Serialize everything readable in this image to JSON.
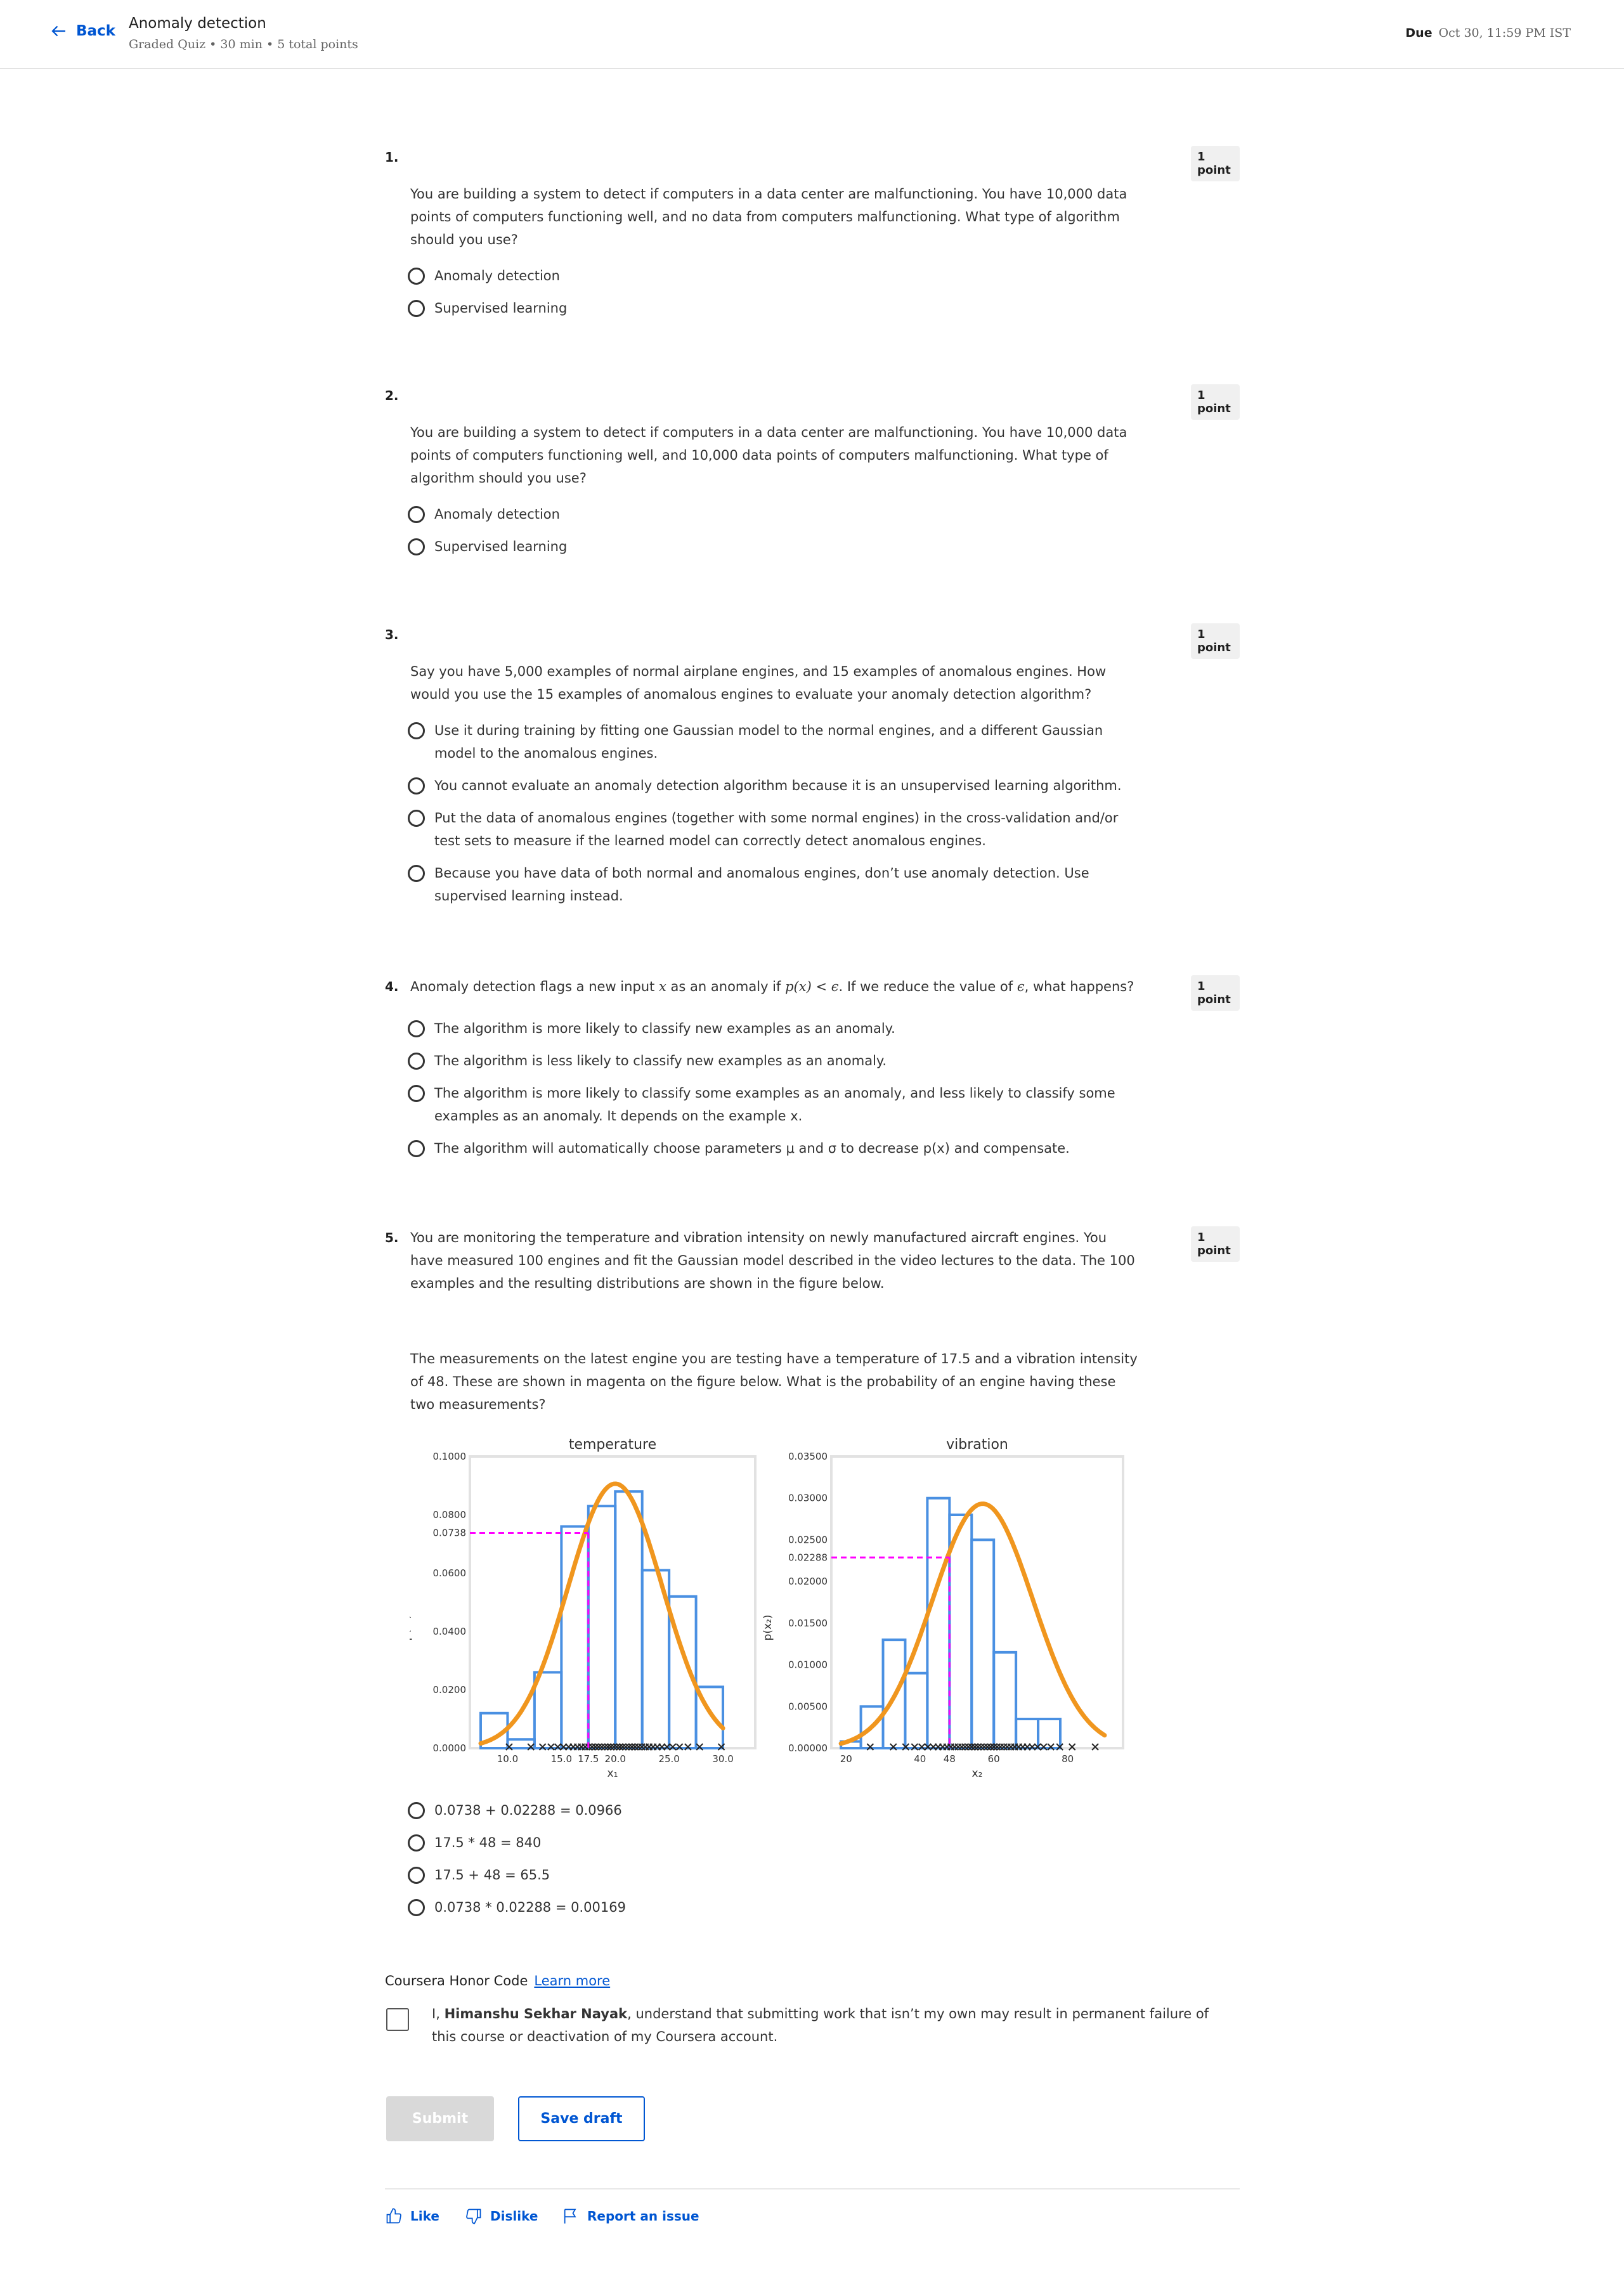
{
  "header": {
    "back_label": "Back",
    "title": "Anomaly detection",
    "subtitle": "Graded Quiz • 30 min • 5 total points",
    "due_label": "Due",
    "due_value": "Oct 30, 11:59 PM IST"
  },
  "questions": [
    {
      "number": "1.",
      "points": "1 point",
      "text": "You are building a system to detect if computers in a data center are malfunctioning. You have 10,000 data points of computers functioning well, and no data from computers malfunctioning. What type of algorithm should you use?",
      "options": [
        "Anomaly detection",
        "Supervised learning"
      ]
    },
    {
      "number": "2.",
      "points": "1 point",
      "text": "You are building a system to detect if computers in a data center are malfunctioning. You have 10,000 data points of computers functioning well, and 10,000 data points of computers malfunctioning. What type of algorithm should you use?",
      "options": [
        "Anomaly detection",
        "Supervised learning"
      ]
    },
    {
      "number": "3.",
      "points": "1 point",
      "text": "Say you have 5,000 examples of normal airplane engines, and 15 examples of anomalous engines. How would you use the 15 examples of anomalous engines to evaluate your anomaly detection algorithm?",
      "options": [
        "Use it during training by fitting one Gaussian model to the normal engines, and a different Gaussian model to the anomalous engines.",
        "You cannot evaluate an anomaly detection algorithm because it is an unsupervised learning algorithm.",
        "Put the data of anomalous engines (together with some normal engines) in the cross-validation and/or test sets to measure if the learned model can correctly detect anomalous engines.",
        "Because you have data of both normal and anomalous engines, don’t use anomaly detection. Use supervised learning instead."
      ]
    },
    {
      "number": "4.",
      "points": "1 point",
      "text_a": "Anomaly detection flags a new input",
      "text_b": "as an anomaly if",
      "text_c": ". If we reduce the value of",
      "text_d": ", what happens?",
      "math_x": "x",
      "math_cond": "p(x) < ϵ",
      "math_eps": "ϵ",
      "options": [
        "The algorithm is more likely to classify new examples as an anomaly.",
        "The algorithm is less likely to classify new examples as an anomaly.",
        "The algorithm is more likely to classify some examples as an anomaly, and less likely to classify some examples as an anomaly. It depends on the example x.",
        "The algorithm will automatically choose parameters μ and σ to decrease p(x) and compensate."
      ]
    },
    {
      "number": "5.",
      "points": "1 point",
      "text": "You are monitoring the temperature and vibration intensity on newly manufactured aircraft engines. You have measured 100 engines and fit the Gaussian model described in the video lectures to the data. The 100 examples and the resulting distributions are shown in the figure below.",
      "text2": "The measurements on the latest engine you are testing have a temperature of 17.5 and a vibration intensity of 48. These are shown in magenta on the figure below. What is the probability of an engine having these two measurements?",
      "options": [
        "0.0738 + 0.02288 = 0.0966",
        "17.5 * 48 = 840",
        "17.5 + 48 = 65.5",
        "0.0738 * 0.02288 = 0.00169"
      ]
    }
  ],
  "chart_data": [
    {
      "type": "bar",
      "title": "temperature",
      "xlabel": "x₁",
      "ylabel": "p(x₁)",
      "xlim": [
        6.5,
        33.0
      ],
      "ylim": [
        0,
        0.1
      ],
      "yticks": [
        "0.1000",
        "0.0800",
        "0.0738",
        "0.0600",
        "0.0400",
        "0.0200",
        "0.0000"
      ],
      "ytick_values": [
        0.1,
        0.08,
        0.0738,
        0.06,
        0.04,
        0.02,
        0.0
      ],
      "xticks": [
        "10.0",
        "15.0",
        "17.5",
        "20.0",
        "25.0",
        "30.0"
      ],
      "xtick_values": [
        10,
        15,
        17.5,
        20,
        25,
        30
      ],
      "bin_edges": [
        7.5,
        10,
        12.5,
        15,
        17.5,
        20,
        22.5,
        25,
        27.5,
        30
      ],
      "hist_values": [
        0.012,
        0.003,
        0.026,
        0.076,
        0.083,
        0.088,
        0.061,
        0.052,
        0.021,
        0.012
      ],
      "gaussian": {
        "mu": 20.0,
        "sigma": 4.4
      },
      "highlight": {
        "x": 17.5,
        "y": 0.0738
      }
    },
    {
      "type": "bar",
      "title": "vibration",
      "xlabel": "x₂",
      "ylabel": "p(x₂)",
      "xlim": [
        16,
        95
      ],
      "ylim": [
        0,
        0.035
      ],
      "yticks": [
        "0.03500",
        "0.03000",
        "0.02500",
        "0.02288",
        "0.02000",
        "0.01500",
        "0.01000",
        "0.00500",
        "0.00000"
      ],
      "ytick_values": [
        0.035,
        0.03,
        0.025,
        0.02288,
        0.02,
        0.015,
        0.01,
        0.005,
        0.0
      ],
      "xticks": [
        "20",
        "40",
        "48",
        "60",
        "80"
      ],
      "xtick_values": [
        20,
        40,
        48,
        60,
        80
      ],
      "bin_edges": [
        18.6,
        24,
        30,
        36,
        42,
        48,
        54,
        60,
        66,
        72,
        78,
        84,
        90
      ],
      "hist_values": [
        0.0008,
        0.005,
        0.013,
        0.009,
        0.03,
        0.028,
        0.025,
        0.0115,
        0.0035,
        0.0035
      ],
      "gaussian": {
        "mu": 57.0,
        "sigma": 13.6
      },
      "highlight": {
        "x": 48,
        "y": 0.02288
      }
    }
  ],
  "honor": {
    "title": "Coursera Honor Code",
    "learn_more": "Learn more",
    "text_prefix": "I,",
    "name": "Himanshu Sekhar Nayak",
    "text_suffix": ", understand that submitting work that isn’t my own may result in permanent failure of this course or deactivation of my Coursera account."
  },
  "buttons": {
    "submit": "Submit",
    "save_draft": "Save draft"
  },
  "footer": {
    "like": "Like",
    "dislike": "Dislike",
    "report": "Report an issue"
  },
  "colors": {
    "accent": "#0056d2",
    "histogram": "#4a90e2",
    "curve": "#f0961e",
    "highlight": "#ff00ff"
  }
}
